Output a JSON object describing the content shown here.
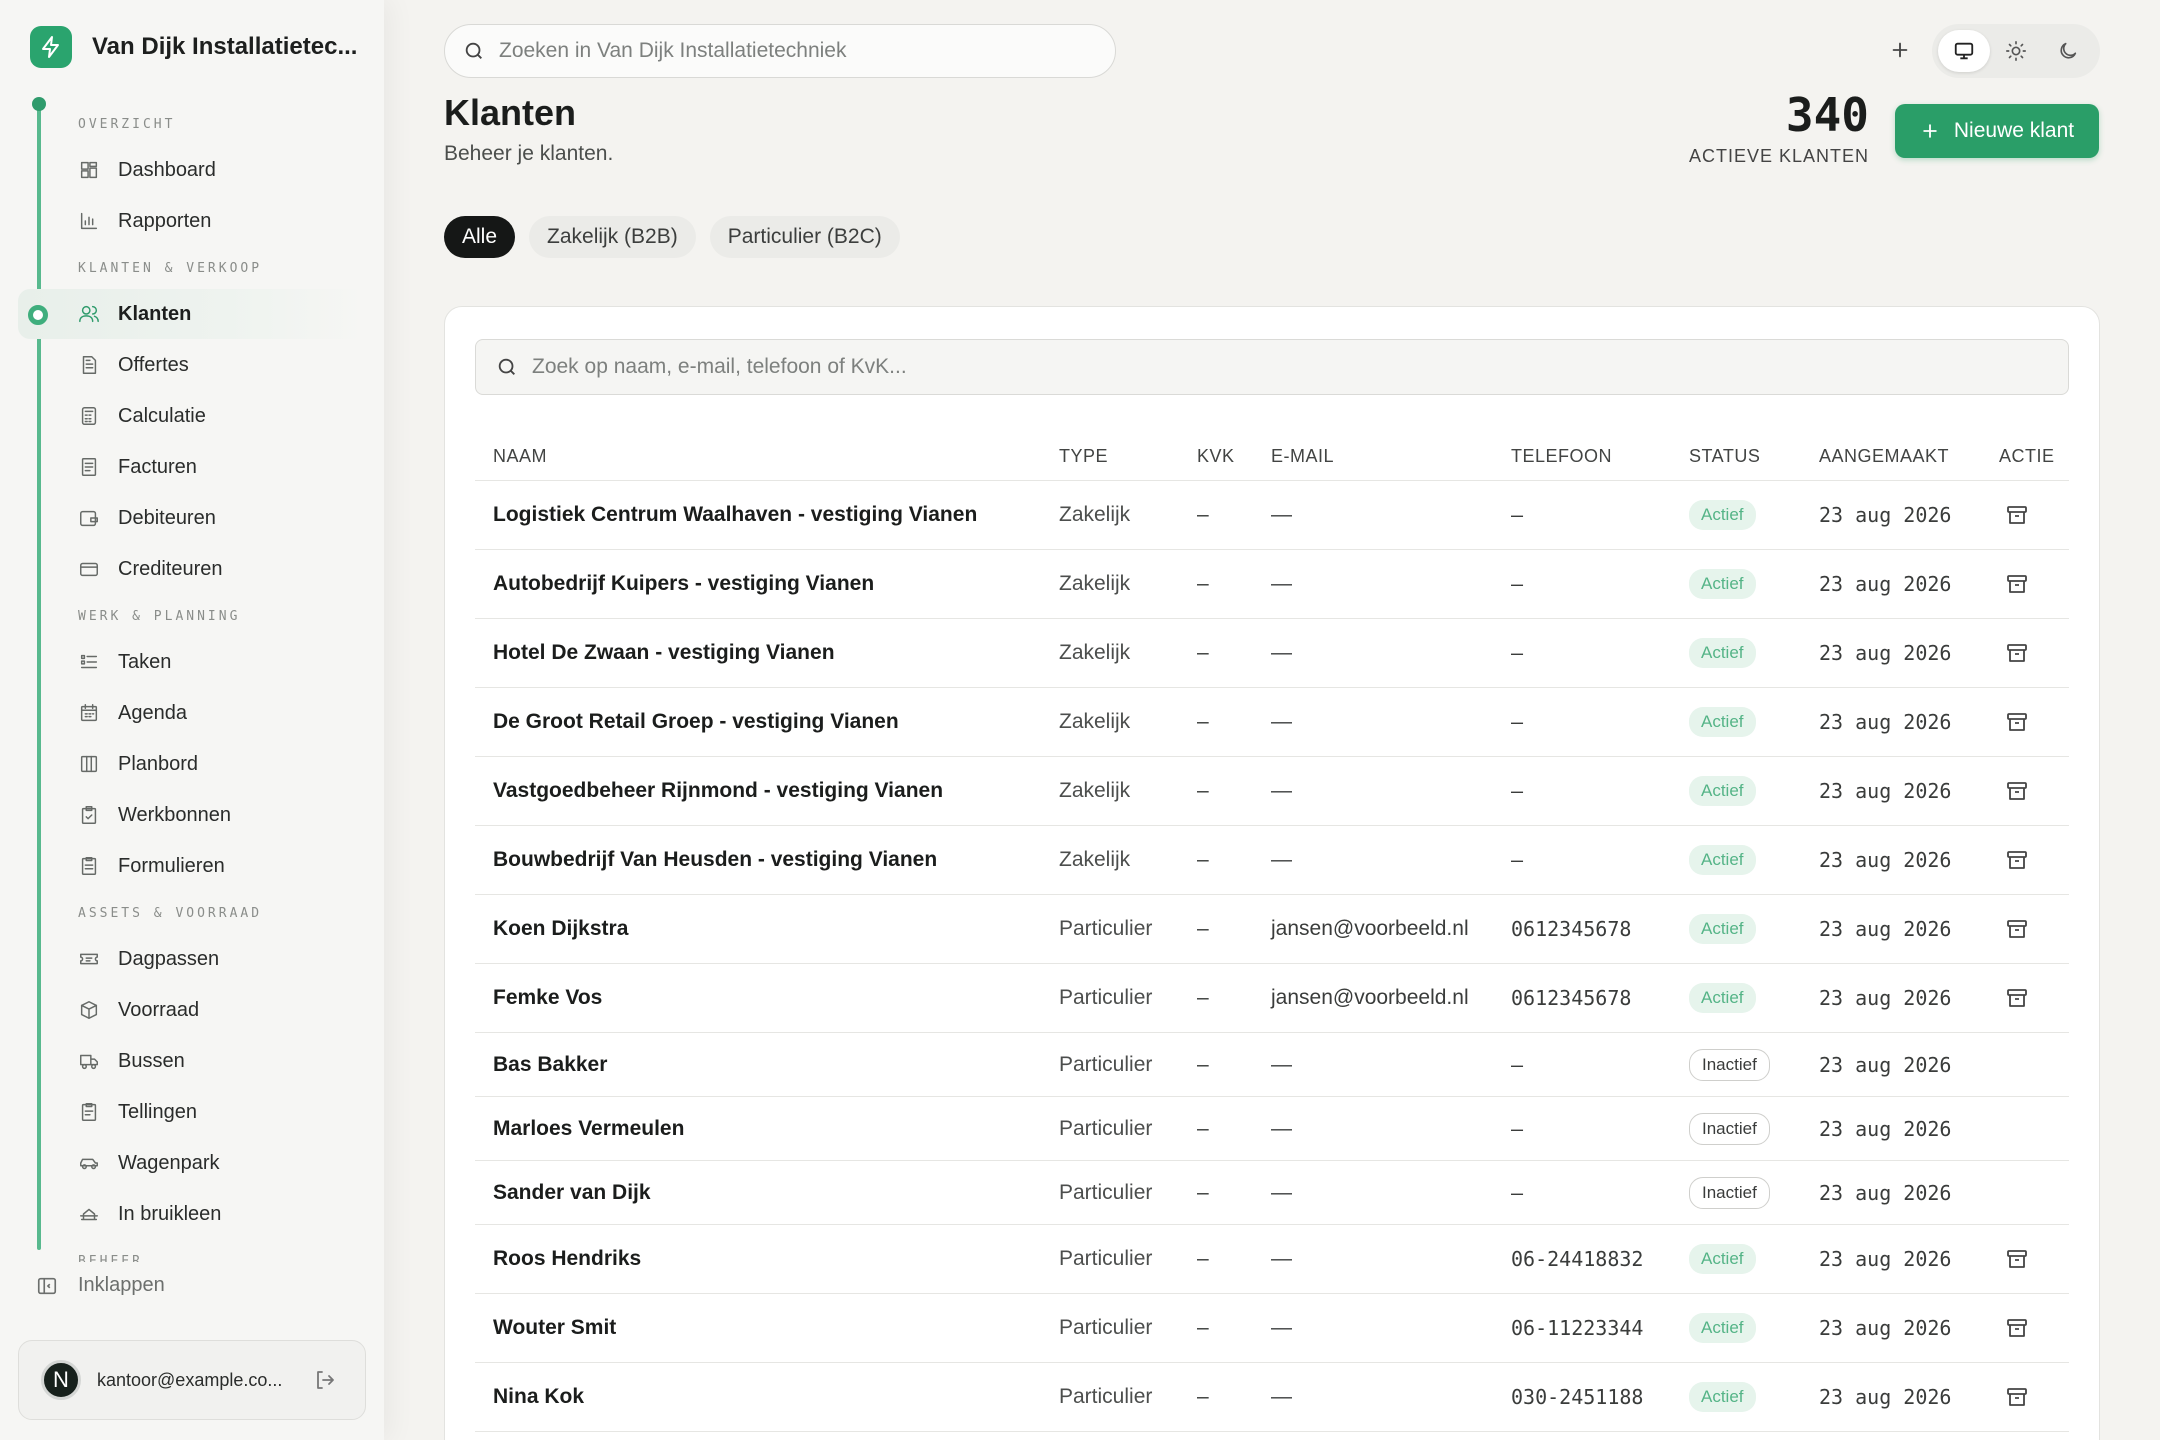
{
  "brand": {
    "name": "Van Dijk Installatietec..."
  },
  "sidebar": {
    "sections": [
      {
        "label": "OVERZICHT",
        "items": [
          {
            "label": "Dashboard",
            "icon": "dashboard-icon"
          },
          {
            "label": "Rapporten",
            "icon": "bar-chart-icon"
          }
        ]
      },
      {
        "label": "KLANTEN & VERKOOP",
        "items": [
          {
            "label": "Klanten",
            "icon": "users-icon",
            "active": true
          },
          {
            "label": "Offertes",
            "icon": "document-icon"
          },
          {
            "label": "Calculatie",
            "icon": "calculator-icon"
          },
          {
            "label": "Facturen",
            "icon": "invoice-icon"
          },
          {
            "label": "Debiteuren",
            "icon": "wallet-icon"
          },
          {
            "label": "Crediteuren",
            "icon": "card-icon"
          }
        ]
      },
      {
        "label": "WERK & PLANNING",
        "items": [
          {
            "label": "Taken",
            "icon": "tasks-icon"
          },
          {
            "label": "Agenda",
            "icon": "calendar-icon"
          },
          {
            "label": "Planbord",
            "icon": "columns-icon"
          },
          {
            "label": "Werkbonnen",
            "icon": "clipboard-icon"
          },
          {
            "label": "Formulieren",
            "icon": "form-icon"
          }
        ]
      },
      {
        "label": "ASSETS & VOORRAAD",
        "items": [
          {
            "label": "Dagpassen",
            "icon": "ticket-icon"
          },
          {
            "label": "Voorraad",
            "icon": "box-icon"
          },
          {
            "label": "Bussen",
            "icon": "truck-icon"
          },
          {
            "label": "Tellingen",
            "icon": "count-icon"
          },
          {
            "label": "Wagenpark",
            "icon": "car-icon"
          },
          {
            "label": "In bruikleen",
            "icon": "loan-icon"
          }
        ]
      }
    ],
    "clipped_section": "BEHEER",
    "collapse_label": "Inklappen",
    "user": {
      "initial": "N",
      "email": "kantoor@example.co..."
    }
  },
  "topbar": {
    "search_placeholder": "Zoeken in Van Dijk Installatietechniek"
  },
  "header": {
    "title": "Klanten",
    "subtitle": "Beheer je klanten.",
    "kpi_value": "340",
    "kpi_label": "ACTIEVE KLANTEN",
    "new_button": "Nieuwe klant"
  },
  "tabs": [
    {
      "label": "Alle",
      "active": true
    },
    {
      "label": "Zakelijk (B2B)"
    },
    {
      "label": "Particulier (B2C)"
    }
  ],
  "table": {
    "search_placeholder": "Zoek op naam, e-mail, telefoon of KvK...",
    "columns": [
      "NAAM",
      "TYPE",
      "KVK",
      "E-MAIL",
      "TELEFOON",
      "STATUS",
      "AANGEMAAKT",
      "ACTIE"
    ],
    "rows": [
      {
        "name": "Logistiek Centrum Waalhaven - vestiging Vianen",
        "type": "Zakelijk",
        "kvk": "–",
        "email": "—",
        "phone": "–",
        "status": "Actief",
        "created": "23 aug 2026",
        "archive": true
      },
      {
        "name": "Autobedrijf Kuipers - vestiging Vianen",
        "type": "Zakelijk",
        "kvk": "–",
        "email": "—",
        "phone": "–",
        "status": "Actief",
        "created": "23 aug 2026",
        "archive": true
      },
      {
        "name": "Hotel De Zwaan - vestiging Vianen",
        "type": "Zakelijk",
        "kvk": "–",
        "email": "—",
        "phone": "–",
        "status": "Actief",
        "created": "23 aug 2026",
        "archive": true
      },
      {
        "name": "De Groot Retail Groep - vestiging Vianen",
        "type": "Zakelijk",
        "kvk": "–",
        "email": "—",
        "phone": "–",
        "status": "Actief",
        "created": "23 aug 2026",
        "archive": true
      },
      {
        "name": "Vastgoedbeheer Rijnmond - vestiging Vianen",
        "type": "Zakelijk",
        "kvk": "–",
        "email": "—",
        "phone": "–",
        "status": "Actief",
        "created": "23 aug 2026",
        "archive": true
      },
      {
        "name": "Bouwbedrijf Van Heusden - vestiging Vianen",
        "type": "Zakelijk",
        "kvk": "–",
        "email": "—",
        "phone": "–",
        "status": "Actief",
        "created": "23 aug 2026",
        "archive": true
      },
      {
        "name": "Koen Dijkstra",
        "type": "Particulier",
        "kvk": "–",
        "email": "jansen@voorbeeld.nl",
        "phone": "0612345678",
        "status": "Actief",
        "created": "23 aug 2026",
        "archive": true
      },
      {
        "name": "Femke Vos",
        "type": "Particulier",
        "kvk": "–",
        "email": "jansen@voorbeeld.nl",
        "phone": "0612345678",
        "status": "Actief",
        "created": "23 aug 2026",
        "archive": true
      },
      {
        "name": "Bas Bakker",
        "type": "Particulier",
        "kvk": "–",
        "email": "—",
        "phone": "–",
        "status": "Inactief",
        "created": "23 aug 2026",
        "archive": false
      },
      {
        "name": "Marloes Vermeulen",
        "type": "Particulier",
        "kvk": "–",
        "email": "—",
        "phone": "–",
        "status": "Inactief",
        "created": "23 aug 2026",
        "archive": false
      },
      {
        "name": "Sander van Dijk",
        "type": "Particulier",
        "kvk": "–",
        "email": "—",
        "phone": "–",
        "status": "Inactief",
        "created": "23 aug 2026",
        "archive": false
      },
      {
        "name": "Roos Hendriks",
        "type": "Particulier",
        "kvk": "–",
        "email": "—",
        "phone": "06-24418832",
        "status": "Actief",
        "created": "23 aug 2026",
        "archive": true
      },
      {
        "name": "Wouter Smit",
        "type": "Particulier",
        "kvk": "–",
        "email": "—",
        "phone": "06-11223344",
        "status": "Actief",
        "created": "23 aug 2026",
        "archive": true
      },
      {
        "name": "Nina Kok",
        "type": "Particulier",
        "kvk": "–",
        "email": "—",
        "phone": "030-2451188",
        "status": "Actief",
        "created": "23 aug 2026",
        "archive": true
      }
    ]
  },
  "colors": {
    "accent": "#2a9e68",
    "active_badge_bg": "#e6f4ec",
    "active_badge_text": "#55b487",
    "rail": "#58b98e"
  }
}
